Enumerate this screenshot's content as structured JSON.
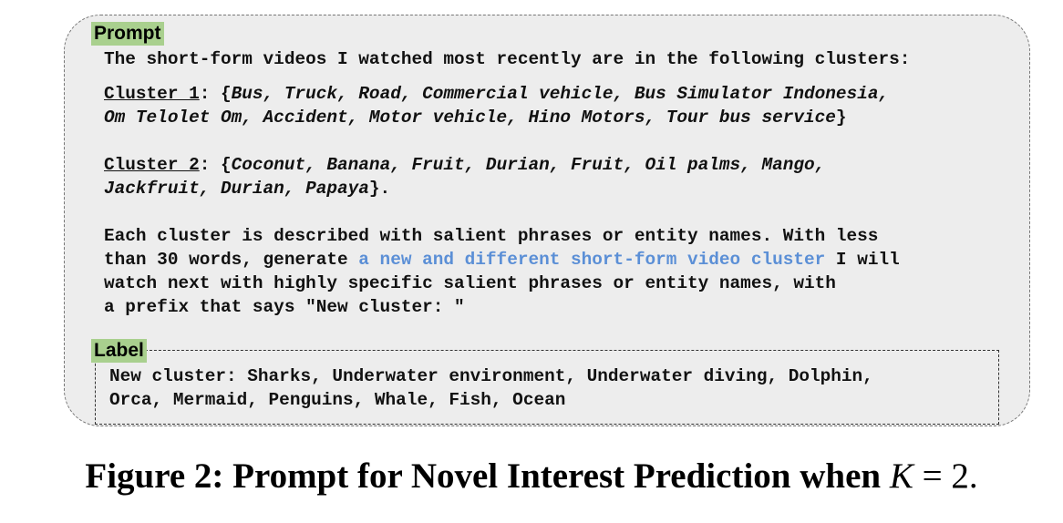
{
  "prompt": {
    "tag": "Prompt",
    "intro": "The short-form videos I watched most recently are in the following clusters:",
    "cluster1": {
      "name": "Cluster 1",
      "colon_open": ": {",
      "line1_items": "Bus, Truck, Road, Commercial vehicle, Bus Simulator Indonesia,",
      "line2_items": "Om Telolet Om, Accident, Motor vehicle, Hino Motors, Tour bus service",
      "close": "}"
    },
    "cluster2": {
      "name": "Cluster 2",
      "colon_open": ": {",
      "line1_items": "Coconut, Banana, Fruit, Durian, Fruit, Oil palms, Mango,",
      "line2_items": "Jackfruit, Durian, Papaya",
      "close": "}."
    },
    "instruction": {
      "line1": "Each cluster is described with salient phrases or entity names. With less",
      "line2_before": "than 30 words, generate ",
      "line2_highlight": "a new and different short-form video cluster",
      "line2_after": " I will",
      "line3": "watch next with highly specific salient phrases or entity names, with",
      "line4": "a prefix that says \"New cluster: \""
    }
  },
  "label": {
    "tag": "Label",
    "line1": "New cluster: Sharks, Underwater environment, Underwater diving, Dolphin,",
    "line2": "Orca, Mermaid, Penguins, Whale, Fish, Ocean"
  },
  "caption": {
    "text": "Figure 2: Prompt for Novel Interest Prediction when ",
    "variable": "K",
    "equals": " = ",
    "value": "2."
  },
  "colors": {
    "tag_background": "#a9d08e",
    "box_background": "#ededed",
    "highlight": "#5b8fd6"
  }
}
